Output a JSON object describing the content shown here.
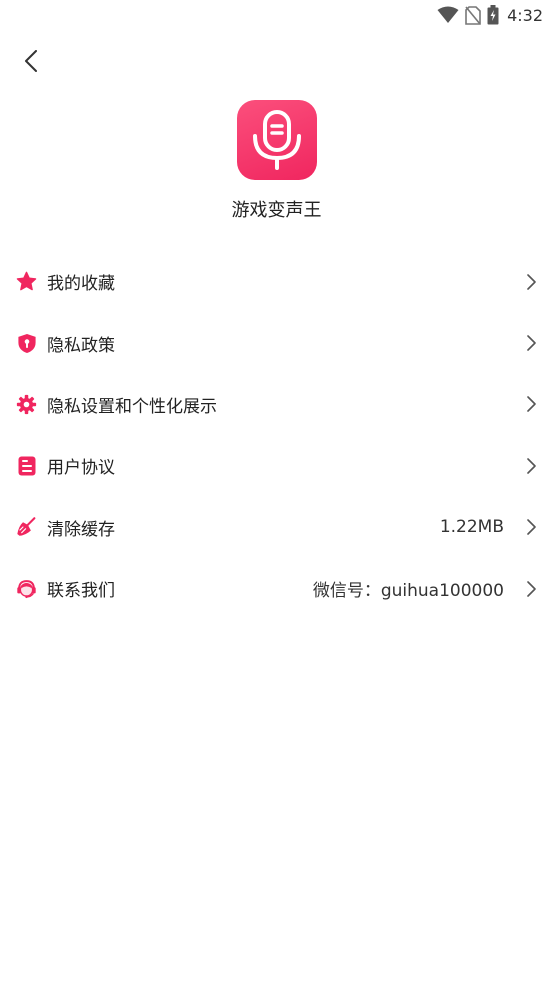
{
  "status_bar": {
    "time": "4:32",
    "icons": [
      "wifi-icon",
      "no-sim-icon",
      "battery-charging-icon"
    ]
  },
  "header": {
    "back_icon": "back-arrow-icon",
    "app_icon": "microphone-icon",
    "app_name": "游戏变声王"
  },
  "colors": {
    "accent": "#f0265f",
    "accent_light": "#fb4f7c",
    "text": "#222222",
    "chevron": "#555555"
  },
  "menu": [
    {
      "icon": "star-icon",
      "label": "我的收藏",
      "value": ""
    },
    {
      "icon": "shield-icon",
      "label": "隐私政策",
      "value": ""
    },
    {
      "icon": "gear-icon",
      "label": "隐私设置和个性化展示",
      "value": ""
    },
    {
      "icon": "document-icon",
      "label": "用户协议",
      "value": ""
    },
    {
      "icon": "broom-icon",
      "label": "清除缓存",
      "value": "1.22MB"
    },
    {
      "icon": "customer-service-icon",
      "label": "联系我们",
      "value": "微信号：guihua100000"
    }
  ]
}
